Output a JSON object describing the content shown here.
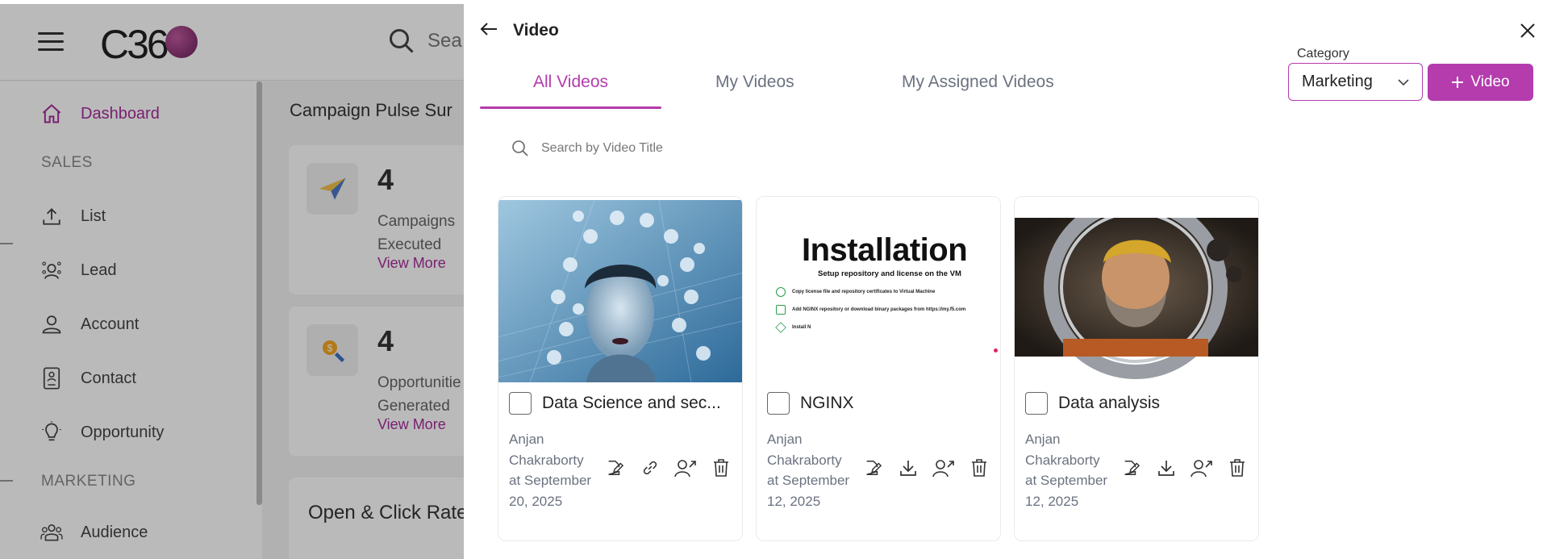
{
  "app": {
    "logo_text": "C36",
    "search_placeholder": "Sea"
  },
  "sidebar": {
    "items": [
      {
        "label": "Dashboard",
        "icon": "home-icon"
      },
      {
        "label": "List",
        "icon": "upload-icon"
      },
      {
        "label": "Lead",
        "icon": "lead-icon"
      },
      {
        "label": "Account",
        "icon": "account-icon"
      },
      {
        "label": "Contact",
        "icon": "contact-icon"
      },
      {
        "label": "Opportunity",
        "icon": "lightbulb-icon"
      },
      {
        "label": "Audience",
        "icon": "audience-icon"
      }
    ],
    "sections": [
      "SALES",
      "MARKETING"
    ]
  },
  "main": {
    "title": "Campaign Pulse Sur",
    "cards": [
      {
        "value": "4",
        "label": "Campaigns Executed",
        "link": "View More"
      },
      {
        "value": "4",
        "label": "Opportunitie Generated",
        "link": "View More"
      }
    ],
    "second_title": "Open & Click Rate"
  },
  "drawer": {
    "title": "Video",
    "tabs": [
      {
        "label": "All Videos",
        "active": true
      },
      {
        "label": "My Videos",
        "active": false
      },
      {
        "label": "My Assigned Videos",
        "active": false
      }
    ],
    "category_label": "Category",
    "category_value": "Marketing",
    "add_button": "Video",
    "search_placeholder": "Search by Video Title",
    "videos": [
      {
        "title": "Data Science and sec...",
        "author": "Anjan Chakraborty",
        "date": "at September 20, 2025",
        "actions": [
          "edit-icon",
          "link-icon",
          "share-icon",
          "delete-icon"
        ]
      },
      {
        "title": "NGINX",
        "author": "Anjan Chakraborty",
        "date": "at September 12, 2025",
        "actions": [
          "edit-icon",
          "download-icon",
          "share-icon",
          "delete-icon"
        ],
        "thumb_heading": "Installation",
        "thumb_sub": "Setup repository and license on the VM",
        "thumb_steps": [
          "Copy license file and repository certificates to Virtual Machine",
          "Add NGINX repository or download binary packages from https://my.f5.com",
          "Install N"
        ]
      },
      {
        "title": "Data analysis",
        "author": "Anjan Chakraborty",
        "date": "at September 12, 2025",
        "actions": [
          "edit-icon",
          "download-icon",
          "share-icon",
          "delete-icon"
        ]
      }
    ]
  },
  "colors": {
    "accent": "#b43cad",
    "sidebar_active": "#a62c9a",
    "muted_text": "#6b7280"
  }
}
